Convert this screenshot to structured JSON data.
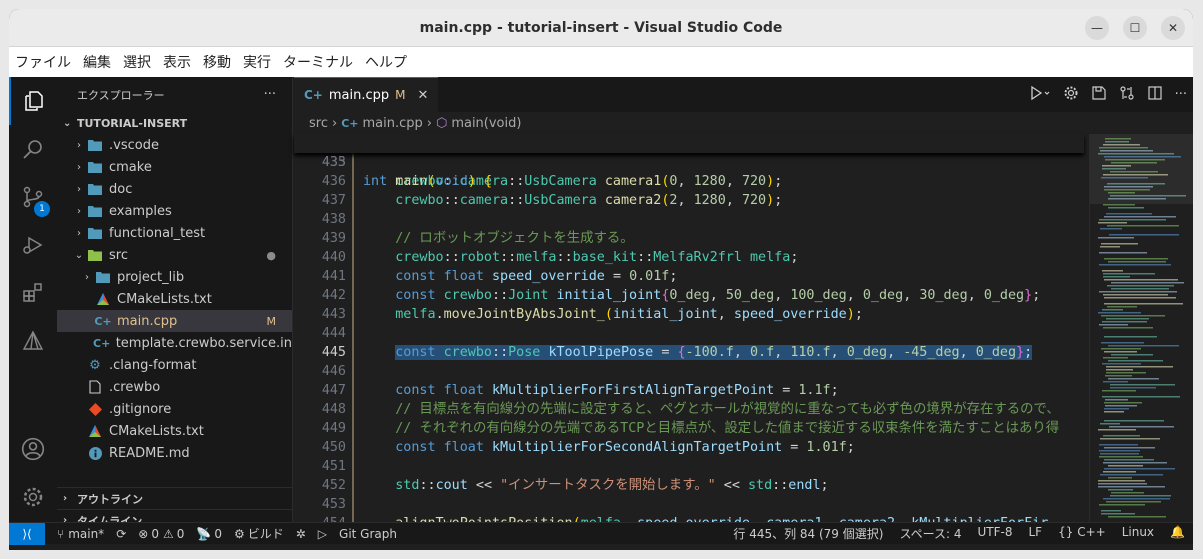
{
  "window": {
    "title": "main.cpp - tutorial-insert - Visual Studio Code"
  },
  "menu": [
    "ファイル",
    "編集",
    "選択",
    "表示",
    "移動",
    "実行",
    "ターミナル",
    "ヘルプ"
  ],
  "activity_bar": {
    "scm_badge": "1"
  },
  "sidebar": {
    "title": "エクスプローラー",
    "more": "···",
    "root": "TUTORIAL-INSERT",
    "items": [
      {
        "label": ".vscode",
        "type": "folder",
        "indent": 0
      },
      {
        "label": "cmake",
        "type": "folder",
        "indent": 0
      },
      {
        "label": "doc",
        "type": "folder",
        "indent": 0
      },
      {
        "label": "examples",
        "type": "folder",
        "indent": 0
      },
      {
        "label": "functional_test",
        "type": "folder",
        "indent": 0
      },
      {
        "label": "src",
        "type": "folder-open",
        "indent": 0,
        "dot": "●"
      },
      {
        "label": "project_lib",
        "type": "folder",
        "indent": 1
      },
      {
        "label": "CMakeLists.txt",
        "type": "cmake",
        "indent": 1
      },
      {
        "label": "main.cpp",
        "type": "cpp",
        "indent": 1,
        "mark": "M",
        "selected": true
      },
      {
        "label": "template.crewbo.service.in",
        "type": "cpp",
        "indent": 1
      },
      {
        "label": ".clang-format",
        "type": "gear",
        "indent": 0
      },
      {
        "label": ".crewbo",
        "type": "file",
        "indent": 0
      },
      {
        "label": ".gitignore",
        "type": "git",
        "indent": 0
      },
      {
        "label": "CMakeLists.txt",
        "type": "cmake",
        "indent": 0
      },
      {
        "label": "README.md",
        "type": "info",
        "indent": 0
      }
    ],
    "sections": [
      "アウトライン",
      "タイムライン"
    ]
  },
  "tab": {
    "label": "main.cpp",
    "mod": "M",
    "close": "✕"
  },
  "breadcrumb": [
    "src",
    "main.cpp",
    "main(void)"
  ],
  "code": {
    "sticky": {
      "num": "433",
      "text": "int main(void) {"
    },
    "current_line": "445",
    "lines": [
      {
        "num": "435",
        "text": ""
      },
      {
        "num": "436",
        "text": "    crewbo::camera::UsbCamera camera1(0, 1280, 720);"
      },
      {
        "num": "437",
        "text": "    crewbo::camera::UsbCamera camera2(2, 1280, 720);"
      },
      {
        "num": "438",
        "text": ""
      },
      {
        "num": "439",
        "text": "    // ロボットオブジェクトを生成する。"
      },
      {
        "num": "440",
        "text": "    crewbo::robot::melfa::base_kit::MelfaRv2frl melfa;"
      },
      {
        "num": "441",
        "text": "    const float speed_override = 0.01f;"
      },
      {
        "num": "442",
        "text": "    const crewbo::Joint initial_joint{0_deg, 50_deg, 100_deg, 0_deg, 30_deg, 0_deg};"
      },
      {
        "num": "443",
        "text": "    melfa.moveJointByAbsJoint_(initial_joint, speed_override);"
      },
      {
        "num": "444",
        "text": ""
      },
      {
        "num": "445",
        "text": "    const crewbo::Pose kToolPipePose = {-100.f, 0.f, 110.f, 0_deg, -45_deg, 0_deg};"
      },
      {
        "num": "446",
        "text": ""
      },
      {
        "num": "447",
        "text": "    const float kMultiplierForFirstAlignTargetPoint = 1.1f;"
      },
      {
        "num": "448",
        "text": "    // 目標点を有向線分の先端に設定すると、ペグとホールが視覚的に重なっても必ず色の境界が存在するので、"
      },
      {
        "num": "449",
        "text": "    // それぞれの有向線分の先端であるTCPと目標点が、設定した値まで接近する収束条件を満たすことはあり得"
      },
      {
        "num": "450",
        "text": "    const float kMultiplierForSecondAlignTargetPoint = 1.01f;"
      },
      {
        "num": "451",
        "text": ""
      },
      {
        "num": "452",
        "text": "    std::cout << \"インサートタスクを開始します。\" << std::endl;"
      },
      {
        "num": "453",
        "text": ""
      },
      {
        "num": "454",
        "text": "    alignTwoPointsPosition(melfa, speed_override, camera1, camera2, kMultiplierForFir"
      }
    ]
  },
  "statusbar": {
    "branch": "main*",
    "errors": "0",
    "warnings": "0",
    "ports": "0",
    "build": "ビルド",
    "git_graph": "Git Graph",
    "position": "行 445、列 84 (79 個選択)",
    "spaces": "スペース: 4",
    "encoding": "UTF-8",
    "eol": "LF",
    "language": "C++",
    "platform": "Linux"
  }
}
